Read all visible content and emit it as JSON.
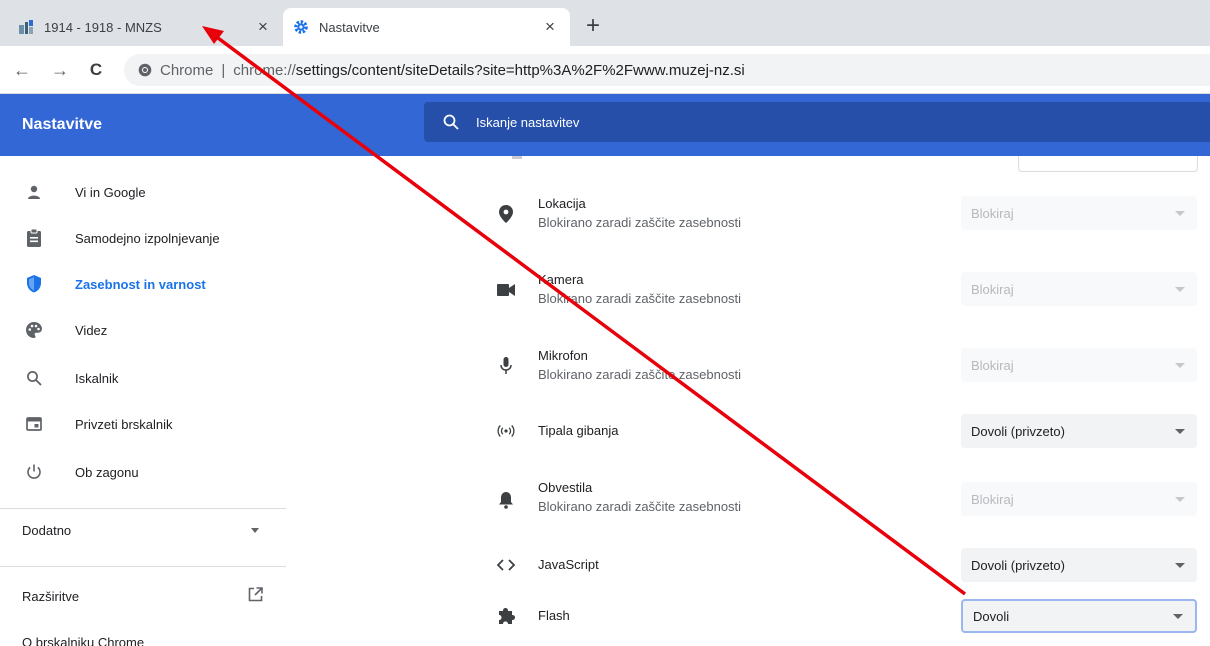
{
  "tabs": [
    {
      "title": "1914 - 1918 - MNZS",
      "close": "×"
    },
    {
      "title": "Nastavitve",
      "close": "×"
    }
  ],
  "new_tab": "+",
  "toolbar": {
    "back": "←",
    "forward": "→",
    "reload": "C",
    "chip": "Chrome",
    "separator": "|",
    "url_scheme": "chrome://",
    "url_rest": "settings/content/siteDetails?site=http%3A%2F%2Fwww.muzej-nz.si"
  },
  "header": {
    "title": "Nastavitve",
    "search_placeholder": "Iskanje nastavitev"
  },
  "sidebar": {
    "items": [
      {
        "label": "Vi in Google",
        "icon": "person-icon"
      },
      {
        "label": "Samodejno izpolnjevanje",
        "icon": "clipboard-icon"
      },
      {
        "label": "Zasebnost in varnost",
        "icon": "shield-icon",
        "selected": true
      },
      {
        "label": "Videz",
        "icon": "palette-icon"
      },
      {
        "label": "Iskalnik",
        "icon": "search-icon"
      },
      {
        "label": "Privzeti brskalnik",
        "icon": "browser-icon"
      },
      {
        "label": "Ob zagonu",
        "icon": "power-icon"
      }
    ],
    "advanced": "Dodatno",
    "extensions": "Razširitve",
    "about": "O brskalniku Chrome"
  },
  "permissions": [
    {
      "name": "Lokacija",
      "desc": "Blokirano zaradi zaščite zasebnosti",
      "value": "Blokiraj",
      "state": "disabled",
      "icon": "location-pin-icon"
    },
    {
      "name": "Kamera",
      "desc": "Blokirano zaradi zaščite zasebnosti",
      "value": "Blokiraj",
      "state": "disabled",
      "icon": "camera-icon"
    },
    {
      "name": "Mikrofon",
      "desc": "Blokirano zaradi zaščite zasebnosti",
      "value": "Blokiraj",
      "state": "disabled",
      "icon": "microphone-icon"
    },
    {
      "name": "Tipala gibanja",
      "desc": "",
      "value": "Dovoli (privzeto)",
      "state": "enabled",
      "icon": "sensors-icon"
    },
    {
      "name": "Obvestila",
      "desc": "Blokirano zaradi zaščite zasebnosti",
      "value": "Blokiraj",
      "state": "disabled",
      "icon": "bell-icon"
    },
    {
      "name": "JavaScript",
      "desc": "",
      "value": "Dovoli (privzeto)",
      "state": "enabled",
      "icon": "code-icon"
    },
    {
      "name": "Flash",
      "desc": "",
      "value": "Dovoli",
      "state": "focused",
      "icon": "puzzle-icon"
    }
  ],
  "colors": {
    "header_blue": "#3367d6",
    "search_blue": "#254fa9",
    "selected_blue": "#1a73e8",
    "annotation_arrow": "#e8000b"
  }
}
